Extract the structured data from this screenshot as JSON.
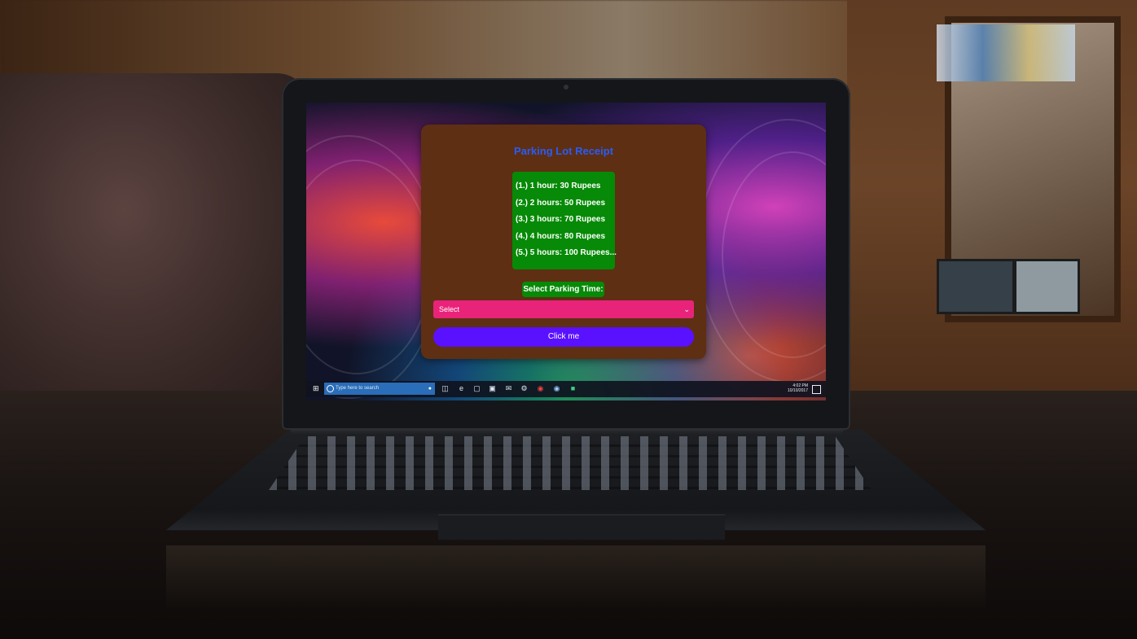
{
  "app": {
    "title": "Parking Lot Receipt",
    "rates": [
      "(1.) 1 hour: 30 Rupees",
      "(2.) 2 hours: 50 Rupees",
      "(3.) 3 hours: 70 Rupees",
      "(4.) 4 hours: 80 Rupees",
      "(5.) 5 hours: 100 Rupees..."
    ],
    "select_label": "Select Parking Time:",
    "select_value": "Select",
    "button_label": "Click me",
    "colors": {
      "card": "#5e2f12",
      "title": "#2a5cf6",
      "rates_bg": "#078a07",
      "select_bg": "#e9237a",
      "button_bg": "#5a11ff"
    }
  },
  "taskbar": {
    "search_placeholder": "Type here to search",
    "time": "4:02 PM",
    "date": "10/10/2017",
    "icons": [
      "windows-start-icon",
      "cortana-icon",
      "microphone-icon",
      "task-view-icon",
      "edge-icon",
      "file-explorer-icon",
      "store-icon",
      "mail-icon",
      "settings-icon",
      "chrome-icon",
      "app-icon",
      "app-icon-2"
    ]
  }
}
